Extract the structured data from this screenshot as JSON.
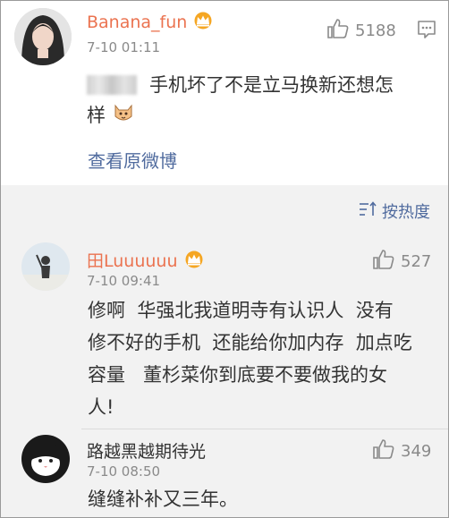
{
  "post": {
    "username": "Banana_fun",
    "time": "7-10 01:11",
    "likes": "5188",
    "text_line1": "手机坏了不是立马换新还想怎",
    "text_line2": "样",
    "view_original": "查看原微博"
  },
  "sort": {
    "label": "按热度"
  },
  "comments": [
    {
      "username": "田Luuuuuu",
      "time": "7-10 09:41",
      "likes": "527",
      "lines": [
        "修啊  华强北我道明寺有认识人  没有",
        "修不好的手机  还能给你加内存  加点吃",
        "容量   董杉菜你到底要不要做我的女",
        "人!"
      ]
    },
    {
      "username": "路越黑越期待光",
      "time": "7-10 08:50",
      "likes": "349",
      "lines": [
        "缝缝补补又三年。"
      ]
    }
  ],
  "colors": {
    "username_orange": "#eb7350",
    "link_blue": "#506b9e",
    "meta_gray": "#8a8a8a",
    "crown_gold": "#f5a623"
  },
  "icons": [
    "crown-icon",
    "thumbs-up-icon",
    "more-options-icon",
    "sort-icon",
    "cat-emoji-icon"
  ]
}
